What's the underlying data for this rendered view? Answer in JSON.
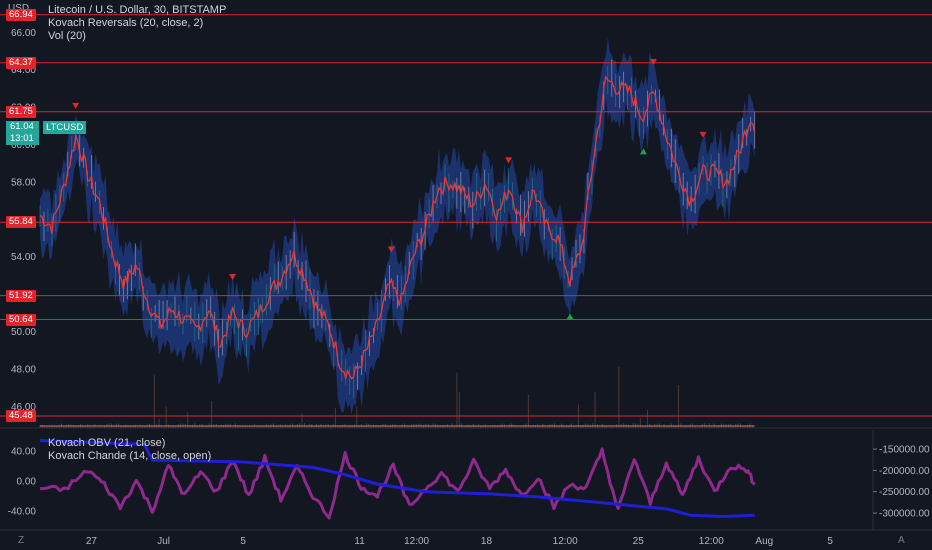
{
  "legend": {
    "title": "Litecoin / U.S. Dollar, 30, BITSTAMP",
    "indicator1": "Kovach Reversals (20, close, 2)",
    "indicator2": "Vol (20)",
    "indicator3": "Kovach OBV (21, close)",
    "indicator4": "Kovach Chande (14, close, open)"
  },
  "axis": {
    "currency": "USD",
    "symbol": "LTCUSD",
    "last_price": "61.04",
    "countdown": "13:01",
    "z_button": "Z",
    "a_button": "A"
  },
  "chart_data": [
    {
      "type": "line",
      "title": "Litecoin / U.S. Dollar, 30, BITSTAMP",
      "series_name": "LTCUSD",
      "y_ticks": [
        "66.00",
        "64.00",
        "62.00",
        "60.00",
        "58.00",
        "56.00",
        "54.00",
        "52.00",
        "50.00",
        "48.00",
        "46.00"
      ],
      "ylim": [
        45.0,
        67.3
      ],
      "x_ticks": [
        "27",
        "Jul",
        "5",
        "11",
        "12:00",
        "18",
        "12:00",
        "25",
        "12:00",
        "Aug",
        "5"
      ],
      "x_tick_positions": [
        0.064,
        0.154,
        0.253,
        0.398,
        0.469,
        0.556,
        0.654,
        0.745,
        0.836,
        0.902,
        0.984
      ],
      "horizontal_levels": [
        "66.94",
        "64.37",
        "61.75",
        "55.84",
        "51.92",
        "50.64",
        "45.48"
      ],
      "horizontal_level_values": [
        66.94,
        64.37,
        61.75,
        55.84,
        51.92,
        50.64,
        45.48
      ],
      "last_price": 61.04,
      "path": [
        [
          0.0,
          56.2
        ],
        [
          0.015,
          55.6
        ],
        [
          0.03,
          57.8
        ],
        [
          0.045,
          60.5
        ],
        [
          0.06,
          58.3
        ],
        [
          0.075,
          56.8
        ],
        [
          0.09,
          54.2
        ],
        [
          0.105,
          52.5
        ],
        [
          0.12,
          53.6
        ],
        [
          0.135,
          51.5
        ],
        [
          0.15,
          50.3
        ],
        [
          0.165,
          51.2
        ],
        [
          0.18,
          50.6
        ],
        [
          0.195,
          50.1
        ],
        [
          0.21,
          51.2
        ],
        [
          0.225,
          49.3
        ],
        [
          0.24,
          51.0
        ],
        [
          0.255,
          50.0
        ],
        [
          0.27,
          50.8
        ],
        [
          0.285,
          52.0
        ],
        [
          0.3,
          52.9
        ],
        [
          0.315,
          54.2
        ],
        [
          0.33,
          53.0
        ],
        [
          0.345,
          51.2
        ],
        [
          0.36,
          50.3
        ],
        [
          0.375,
          48.2
        ],
        [
          0.39,
          47.5
        ],
        [
          0.405,
          48.8
        ],
        [
          0.42,
          50.3
        ],
        [
          0.435,
          52.5
        ],
        [
          0.45,
          51.6
        ],
        [
          0.465,
          54.0
        ],
        [
          0.48,
          55.5
        ],
        [
          0.495,
          57.6
        ],
        [
          0.51,
          58.0
        ],
        [
          0.525,
          57.5
        ],
        [
          0.54,
          56.8
        ],
        [
          0.555,
          58.0
        ],
        [
          0.57,
          56.2
        ],
        [
          0.585,
          57.8
        ],
        [
          0.6,
          55.6
        ],
        [
          0.615,
          57.6
        ],
        [
          0.63,
          55.6
        ],
        [
          0.645,
          55.0
        ],
        [
          0.66,
          52.7
        ],
        [
          0.675,
          54.6
        ],
        [
          0.69,
          59.5
        ],
        [
          0.705,
          63.5
        ],
        [
          0.72,
          63.0
        ],
        [
          0.735,
          62.8
        ],
        [
          0.75,
          61.5
        ],
        [
          0.765,
          62.8
        ],
        [
          0.78,
          60.5
        ],
        [
          0.795,
          58.5
        ],
        [
          0.81,
          57.0
        ],
        [
          0.825,
          58.5
        ],
        [
          0.84,
          58.5
        ],
        [
          0.855,
          58.0
        ],
        [
          0.87,
          59.5
        ],
        [
          0.885,
          61.5
        ],
        [
          0.89,
          61.04
        ]
      ]
    },
    {
      "type": "line",
      "title": "Kovach OBV (21, close) / Kovach Chande (14, close, open)",
      "left_ticks": [
        "40.00",
        "0.00",
        "-40.00"
      ],
      "left_ylim": [
        -63,
        65
      ],
      "right_ticks": [
        "-150000.00",
        "-200000.00",
        "-250000.00",
        "-300000.00"
      ],
      "right_ylim": [
        -335000,
        -110000
      ],
      "series": [
        {
          "name": "Kovach OBV (21, close)",
          "color": "#1f1fd6",
          "points": [
            [
              0.0,
              -130000
            ],
            [
              0.13,
              -139000
            ],
            [
              0.14,
              -176000
            ],
            [
              0.25,
              -180000
            ],
            [
              0.34,
              -193000
            ],
            [
              0.38,
              -210000
            ],
            [
              0.42,
              -232000
            ],
            [
              0.48,
              -250000
            ],
            [
              0.56,
              -255000
            ],
            [
              0.62,
              -262000
            ],
            [
              0.7,
              -276000
            ],
            [
              0.78,
              -290000
            ],
            [
              0.81,
              -305000
            ],
            [
              0.85,
              -308000
            ],
            [
              0.89,
              -305000
            ]
          ]
        },
        {
          "name": "Kovach Chande (14, close, open)",
          "color": "#8e2a8e",
          "points": [
            [
              0.0,
              -10
            ],
            [
              0.03,
              -12
            ],
            [
              0.06,
              14
            ],
            [
              0.08,
              -5
            ],
            [
              0.1,
              -35
            ],
            [
              0.12,
              0
            ],
            [
              0.14,
              -40
            ],
            [
              0.16,
              20
            ],
            [
              0.18,
              -20
            ],
            [
              0.2,
              12
            ],
            [
              0.22,
              -15
            ],
            [
              0.24,
              28
            ],
            [
              0.26,
              -20
            ],
            [
              0.28,
              30
            ],
            [
              0.3,
              -25
            ],
            [
              0.32,
              18
            ],
            [
              0.34,
              -20
            ],
            [
              0.36,
              -48
            ],
            [
              0.38,
              35
            ],
            [
              0.4,
              -8
            ],
            [
              0.42,
              -20
            ],
            [
              0.44,
              20
            ],
            [
              0.46,
              -35
            ],
            [
              0.48,
              -10
            ],
            [
              0.5,
              10
            ],
            [
              0.52,
              -15
            ],
            [
              0.54,
              25
            ],
            [
              0.56,
              -10
            ],
            [
              0.58,
              15
            ],
            [
              0.6,
              -20
            ],
            [
              0.62,
              5
            ],
            [
              0.64,
              -35
            ],
            [
              0.66,
              -5
            ],
            [
              0.68,
              -10
            ],
            [
              0.7,
              40
            ],
            [
              0.72,
              -40
            ],
            [
              0.74,
              30
            ],
            [
              0.76,
              -30
            ],
            [
              0.78,
              25
            ],
            [
              0.8,
              -20
            ],
            [
              0.82,
              30
            ],
            [
              0.84,
              -15
            ],
            [
              0.86,
              20
            ],
            [
              0.88,
              15
            ],
            [
              0.89,
              -5
            ]
          ]
        }
      ]
    }
  ],
  "colors": {
    "background": "#131722",
    "level_line": "#e0262c",
    "price_line": "#e53935",
    "band": "#1f3c88",
    "up_marker": "#1e9e52",
    "down_marker": "#e0262c",
    "obv": "#1f1fd6",
    "chande": "#8e2a8e",
    "axis_text": "#b2b5be"
  }
}
